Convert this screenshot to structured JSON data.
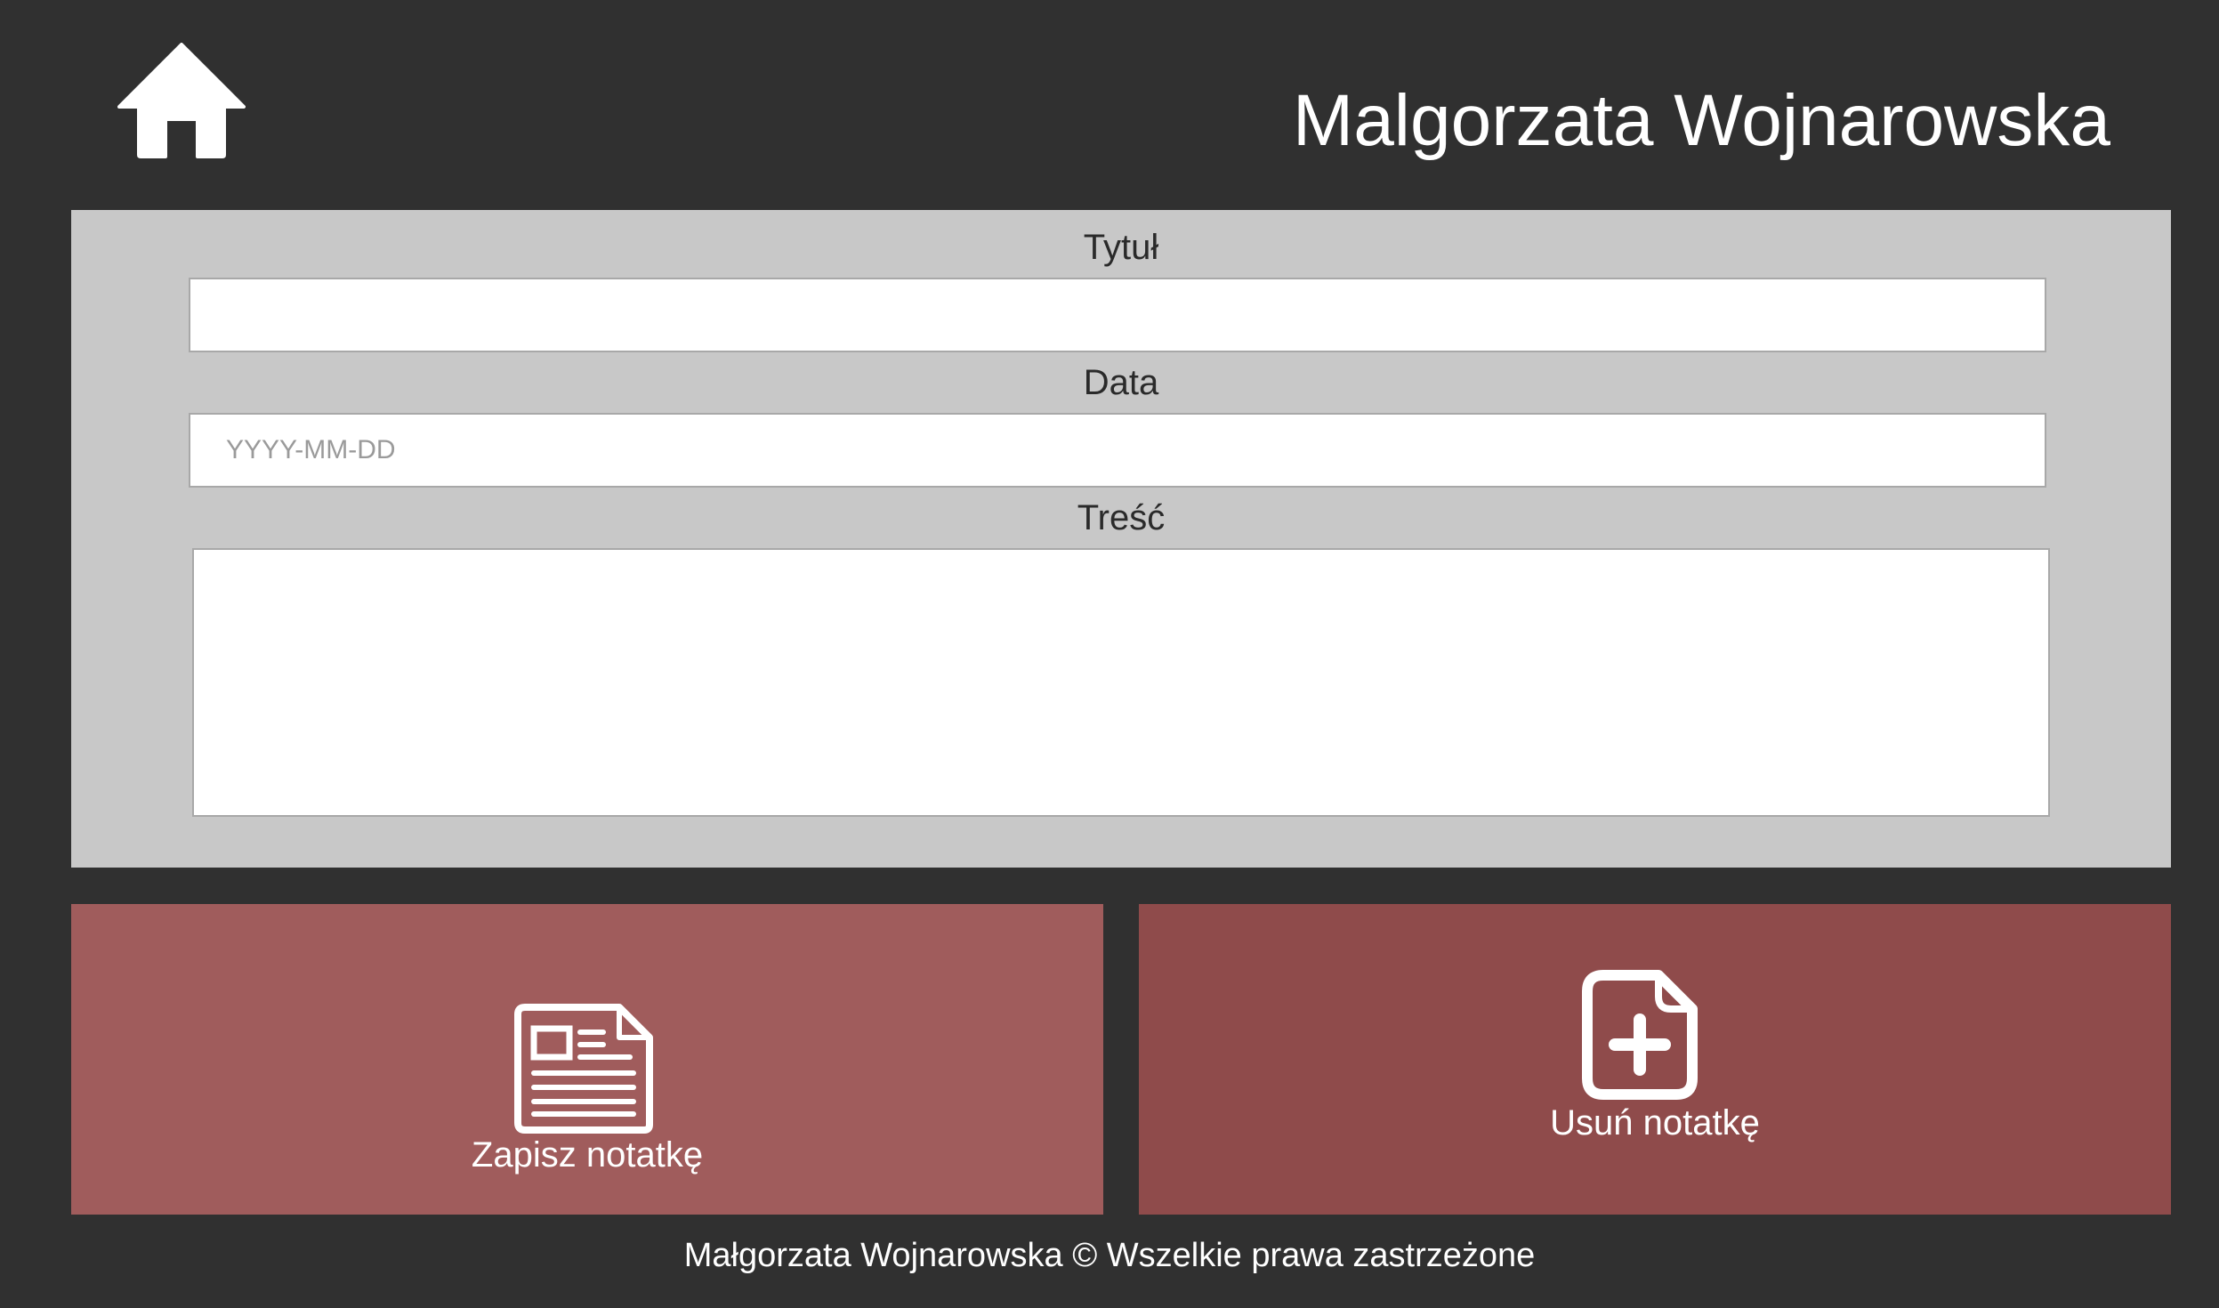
{
  "header": {
    "home_icon": "home-icon",
    "user_name": "Malgorzata Wojnarowska"
  },
  "form": {
    "title_label": "Tytuł",
    "title_value": "",
    "date_label": "Data",
    "date_placeholder": "YYYY-MM-DD",
    "date_value": "",
    "content_label": "Treść",
    "content_value": ""
  },
  "actions": {
    "save": {
      "label": "Zapisz notatkę",
      "icon": "newspaper-icon"
    },
    "delete": {
      "label": "Usuń notatkę",
      "icon": "file-plus-icon"
    }
  },
  "footer": {
    "text": "Małgorzata Wojnarowska © Wszelkie prawa zastrzeżone"
  },
  "colors": {
    "background": "#303030",
    "panel": "#c8c8c8",
    "save_button": "#a05c5c",
    "delete_button": "#8f4b4b",
    "text_light": "#ffffff"
  }
}
